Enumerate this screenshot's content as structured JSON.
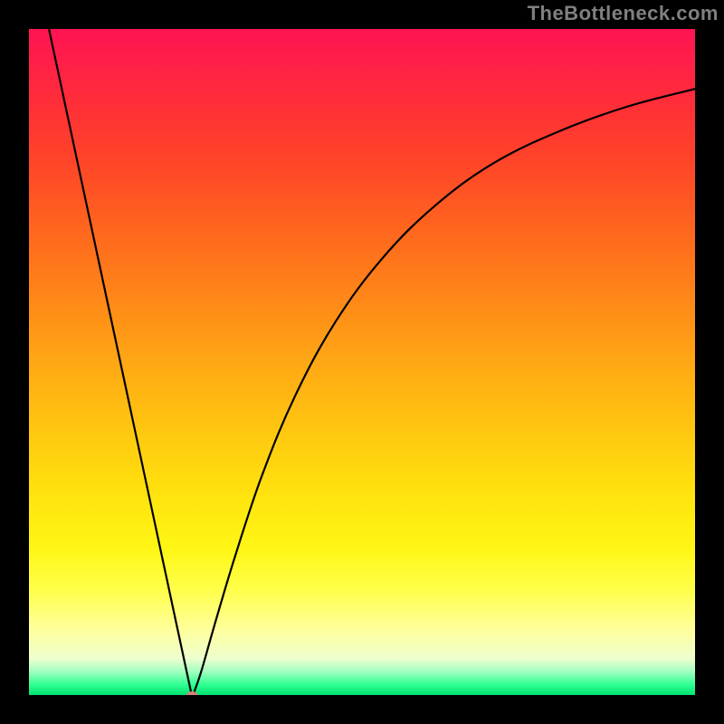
{
  "watermark": "TheBottleneck.com",
  "chart_data": {
    "type": "line",
    "title": "",
    "xlabel": "",
    "ylabel": "",
    "xlim": [
      0,
      100
    ],
    "ylim": [
      0,
      100
    ],
    "background": {
      "type": "vertical-gradient",
      "stops": [
        {
          "offset": 0.0,
          "color": "#ff1353"
        },
        {
          "offset": 0.05,
          "color": "#ff1f48"
        },
        {
          "offset": 0.12,
          "color": "#ff3036"
        },
        {
          "offset": 0.2,
          "color": "#ff4528"
        },
        {
          "offset": 0.3,
          "color": "#ff651e"
        },
        {
          "offset": 0.4,
          "color": "#ff8618"
        },
        {
          "offset": 0.5,
          "color": "#ffa714"
        },
        {
          "offset": 0.6,
          "color": "#ffc610"
        },
        {
          "offset": 0.7,
          "color": "#ffe30e"
        },
        {
          "offset": 0.78,
          "color": "#fff615"
        },
        {
          "offset": 0.84,
          "color": "#ffff48"
        },
        {
          "offset": 0.9,
          "color": "#ffff9a"
        },
        {
          "offset": 0.945,
          "color": "#eeffcf"
        },
        {
          "offset": 0.965,
          "color": "#a0ffc0"
        },
        {
          "offset": 0.985,
          "color": "#2cff90"
        },
        {
          "offset": 1.0,
          "color": "#00e070"
        }
      ]
    },
    "series": [
      {
        "name": "bottleneck-curve",
        "color": "#000000",
        "x": [
          3,
          6,
          9,
          12,
          15,
          18,
          21,
          24,
          24.5,
          25,
          26,
          28,
          31,
          35,
          40,
          46,
          53,
          61,
          70,
          80,
          90,
          100
        ],
        "y": [
          100,
          86,
          72,
          58,
          44,
          30,
          16,
          2,
          0,
          1,
          4,
          11,
          21,
          33,
          45,
          56,
          65.5,
          73.5,
          80,
          84.8,
          88.4,
          91
        ]
      }
    ],
    "markers": [
      {
        "name": "min-point",
        "x": 24.5,
        "y": 0,
        "color": "#d98080",
        "rx": 6,
        "ry": 4
      }
    ],
    "frame": {
      "color": "#000000",
      "thickness_px": 32
    }
  }
}
